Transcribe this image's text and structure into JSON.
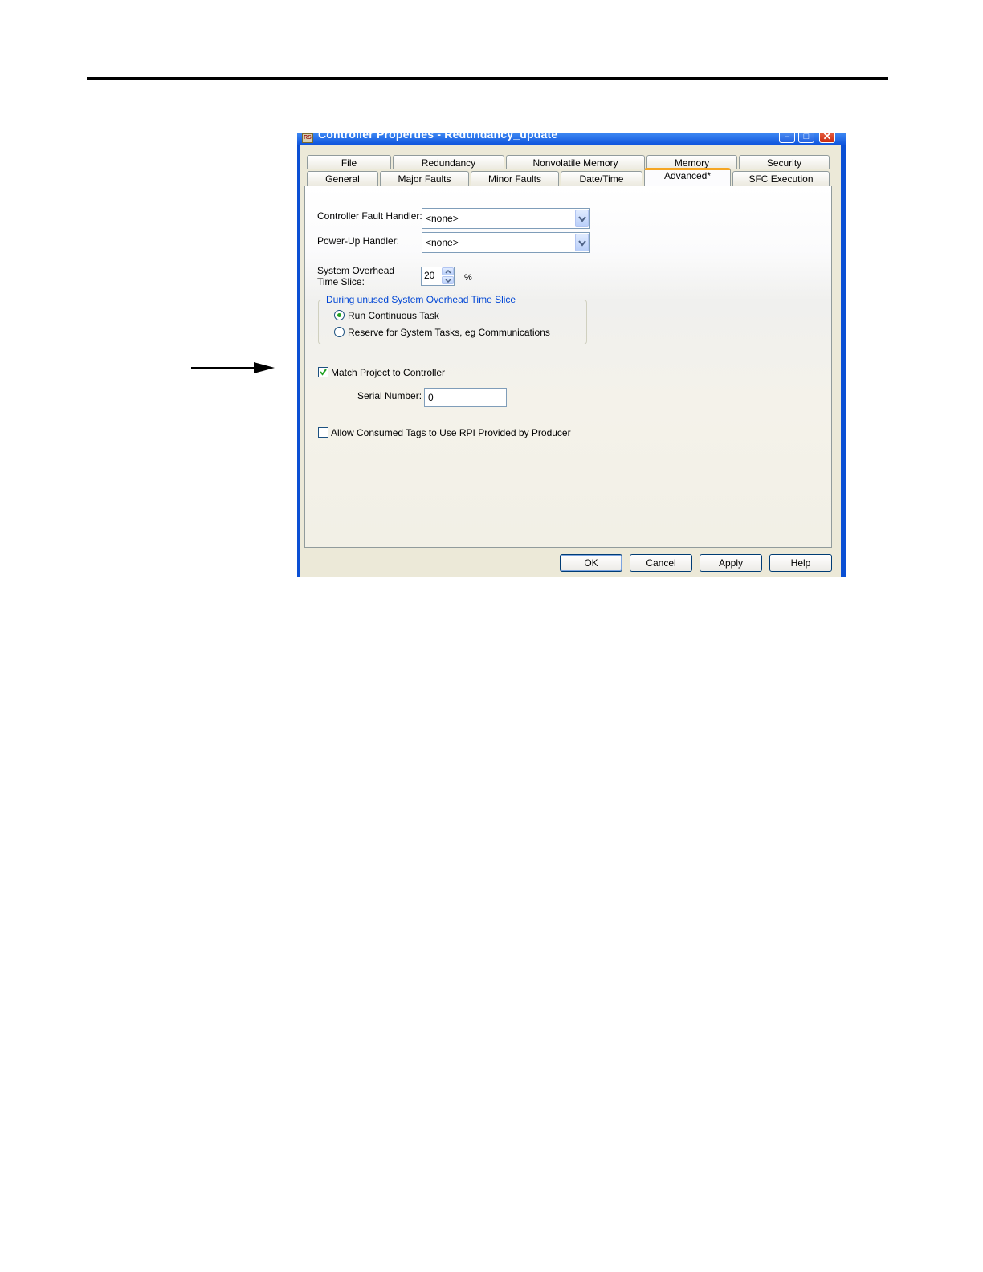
{
  "window": {
    "title": "Controller Properties - Redundancy_update",
    "app_icon": "RS",
    "minimize_glyph": "–",
    "maximize_glyph": "□",
    "close_glyph": "✕"
  },
  "tabs_row1": [
    {
      "label": "File"
    },
    {
      "label": "Redundancy"
    },
    {
      "label": "Nonvolatile Memory"
    },
    {
      "label": "Memory"
    },
    {
      "label": "Security"
    }
  ],
  "tabs_row2": [
    {
      "label": "General"
    },
    {
      "label": "Major Faults"
    },
    {
      "label": "Minor Faults"
    },
    {
      "label": "Date/Time"
    },
    {
      "label": "Advanced*"
    },
    {
      "label": "SFC Execution"
    }
  ],
  "active_tab": "Advanced*",
  "advanced": {
    "fault_handler_label": "Controller Fault Handler:",
    "fault_handler_value": "<none>",
    "powerup_handler_label": "Power-Up Handler:",
    "powerup_handler_value": "<none>",
    "time_slice_label_line1": "System Overhead",
    "time_slice_label_line2": "Time Slice:",
    "time_slice_value": "20",
    "time_slice_unit": "%",
    "group_title": "During unused System Overhead Time Slice",
    "radio_run": "Run Continuous Task",
    "radio_reserve": "Reserve for System Tasks, eg Communications",
    "radio_selected": "Run Continuous Task",
    "match_label": "Match Project to Controller",
    "match_checked": true,
    "serial_label": "Serial Number:",
    "serial_value": "0",
    "allow_label": "Allow Consumed Tags to Use RPI Provided by Producer",
    "allow_checked": false
  },
  "buttons": {
    "ok": "OK",
    "cancel": "Cancel",
    "apply": "Apply",
    "help": "Help"
  },
  "colors": {
    "titlebar": "#0f55dd",
    "active_tab_accent": "#f5a623",
    "group_title": "#0046d5",
    "dialog_bg": "#ece9d8"
  }
}
